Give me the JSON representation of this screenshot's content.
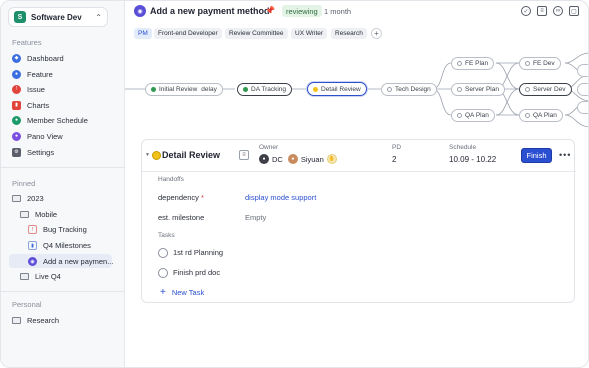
{
  "workspace": {
    "logo": "S",
    "name": "Software Dev"
  },
  "sidebar": {
    "features_title": "Features",
    "features": [
      {
        "label": "Dashboard",
        "icon": "dashboard-icon",
        "color": "#3b6fe0"
      },
      {
        "label": "Feature",
        "icon": "feature-icon",
        "color": "#3b6fe0"
      },
      {
        "label": "Issue",
        "icon": "issue-icon",
        "color": "#e0443b"
      },
      {
        "label": "Charts",
        "icon": "charts-icon",
        "color": "#e0443b"
      },
      {
        "label": "Member Schedule",
        "icon": "member-schedule-icon",
        "color": "#1d9a6c"
      },
      {
        "label": "Pano View",
        "icon": "pano-view-icon",
        "color": "#7b4fe0"
      },
      {
        "label": "Settings",
        "icon": "settings-icon",
        "color": "#5a5f6b"
      }
    ],
    "pinned_title": "Pinned",
    "pinned": {
      "year": "2023",
      "mobile": "Mobile",
      "bug_tracking": "Bug Tracking",
      "q4_milestones": "Q4 Milestones",
      "active": "Add a new paymen...",
      "live_q4": "Live Q4"
    },
    "personal_title": "Personal",
    "research": "Research"
  },
  "header": {
    "title": "Add a new payment method",
    "status": "reviewing",
    "duration": "1 month"
  },
  "tags": [
    "PM",
    "Front-end Developer",
    "Review Committee",
    "UX Writer",
    "Research"
  ],
  "flow": {
    "nodes": {
      "initial_review": "Initial Review",
      "initial_review_flag": "delay",
      "da_tracking": "DA Tracking",
      "detail_review": "Detail Review",
      "tech_design": "Tech Design",
      "fe_plan": "FE Plan",
      "server_plan": "Server Plan",
      "qa_plan": "QA Plan",
      "fe_dev": "FE Dev",
      "server_dev": "Server Dev",
      "qa_plan_2": "QA Plan"
    }
  },
  "stage": {
    "name": "Detail Review",
    "owner_label": "Owner",
    "owners": [
      "DC",
      "Siyuan"
    ],
    "pd_label": "PD",
    "pd": "2",
    "schedule_label": "Schedule",
    "schedule": "10.09 - 10.22",
    "finish": "Finish",
    "handoffs_title": "Handoffs",
    "dependency_label": "dependency",
    "dependency_value": "display mode support",
    "milestone_label": "est. milestone",
    "milestone_value": "Empty",
    "tasks_title": "Tasks",
    "tasks": [
      "1st rd Planning",
      "Finish prd doc"
    ],
    "new_task": "New Task"
  }
}
